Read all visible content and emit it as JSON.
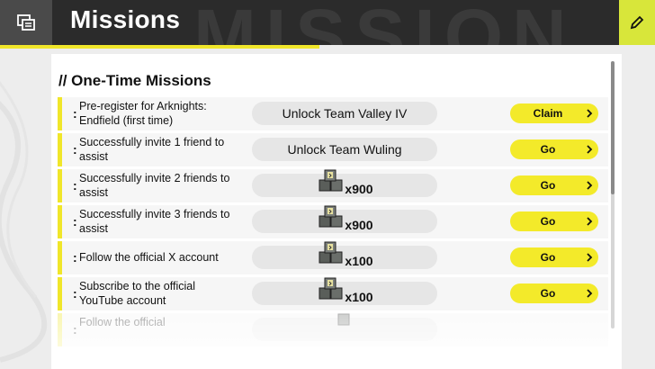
{
  "header": {
    "title": "Missions",
    "watermark": "MISSION",
    "window_icon": "window-list-icon",
    "corner_icon": "pencil-icon"
  },
  "section": {
    "title": "// One-Time Missions"
  },
  "missions": [
    {
      "description": "Pre-register for Arknights: Endfield (first time)",
      "reward": "Unlock Team Valley IV",
      "button": "Claim"
    },
    {
      "description": "Successfully invite 1 friend to assist",
      "reward": "Unlock Team Wuling",
      "button": "Go"
    },
    {
      "description": "Successfully invite 2 friends to assist",
      "reward_qty": "x900",
      "reward_icon": "supply-crate-icon",
      "button": "Go"
    },
    {
      "description": "Successfully invite 3 friends to assist",
      "reward_qty": "x900",
      "reward_icon": "supply-crate-icon",
      "button": "Go"
    },
    {
      "description": "Follow the official X account",
      "reward_qty": "x100",
      "reward_icon": "supply-crate-icon",
      "button": "Go"
    },
    {
      "description": "Subscribe to the official YouTube account",
      "reward_qty": "x100",
      "reward_icon": "supply-crate-icon",
      "button": "Go"
    },
    {
      "description": "Follow the official"
    }
  ],
  "colors": {
    "accent": "#f3ea2a",
    "header_bg": "#2b2b2b",
    "row_bg": "#f6f6f6"
  }
}
